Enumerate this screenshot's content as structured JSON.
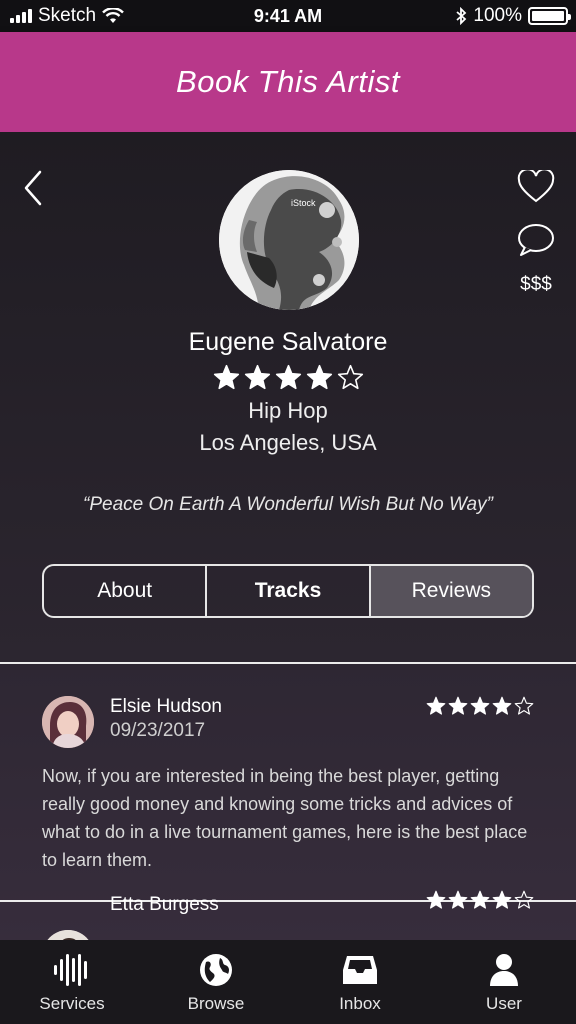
{
  "status_bar": {
    "carrier": "Sketch",
    "time": "9:41 AM",
    "battery": "100%",
    "battery_level": 1.0
  },
  "header": {
    "title": "Book This Artist"
  },
  "profile": {
    "name": "Eugene Salvatore",
    "rating": 4,
    "rating_max": 5,
    "genre": "Hip Hop",
    "location": "Los Angeles, USA",
    "quote": "“Peace On Earth A Wonderful Wish But No Way”",
    "price_label": "$$$",
    "avatar_watermark": "iStock"
  },
  "tabs": [
    {
      "label": "About",
      "selected": false
    },
    {
      "label": "Tracks",
      "selected": false
    },
    {
      "label": "Reviews",
      "selected": true
    }
  ],
  "reviews": [
    {
      "name": "Elsie Hudson",
      "date": "09/23/2017",
      "rating": 4,
      "text": "Now, if you are interested in being the best player, getting really good money and knowing some tricks and advices of what to do in a live tournament games, here is the best place to learn them."
    },
    {
      "name": "Etta Burgess",
      "date": "",
      "rating": 4,
      "text": ""
    }
  ],
  "tabbar": [
    {
      "label": "Services",
      "icon": "soundwave-icon"
    },
    {
      "label": "Browse",
      "icon": "globe-icon"
    },
    {
      "label": "Inbox",
      "icon": "inbox-icon"
    },
    {
      "label": "User",
      "icon": "user-icon"
    }
  ],
  "colors": {
    "header": "#b8388a",
    "background": "#1f1c22",
    "selected_tab": "#57525b",
    "tabbar": "#1a181c"
  }
}
